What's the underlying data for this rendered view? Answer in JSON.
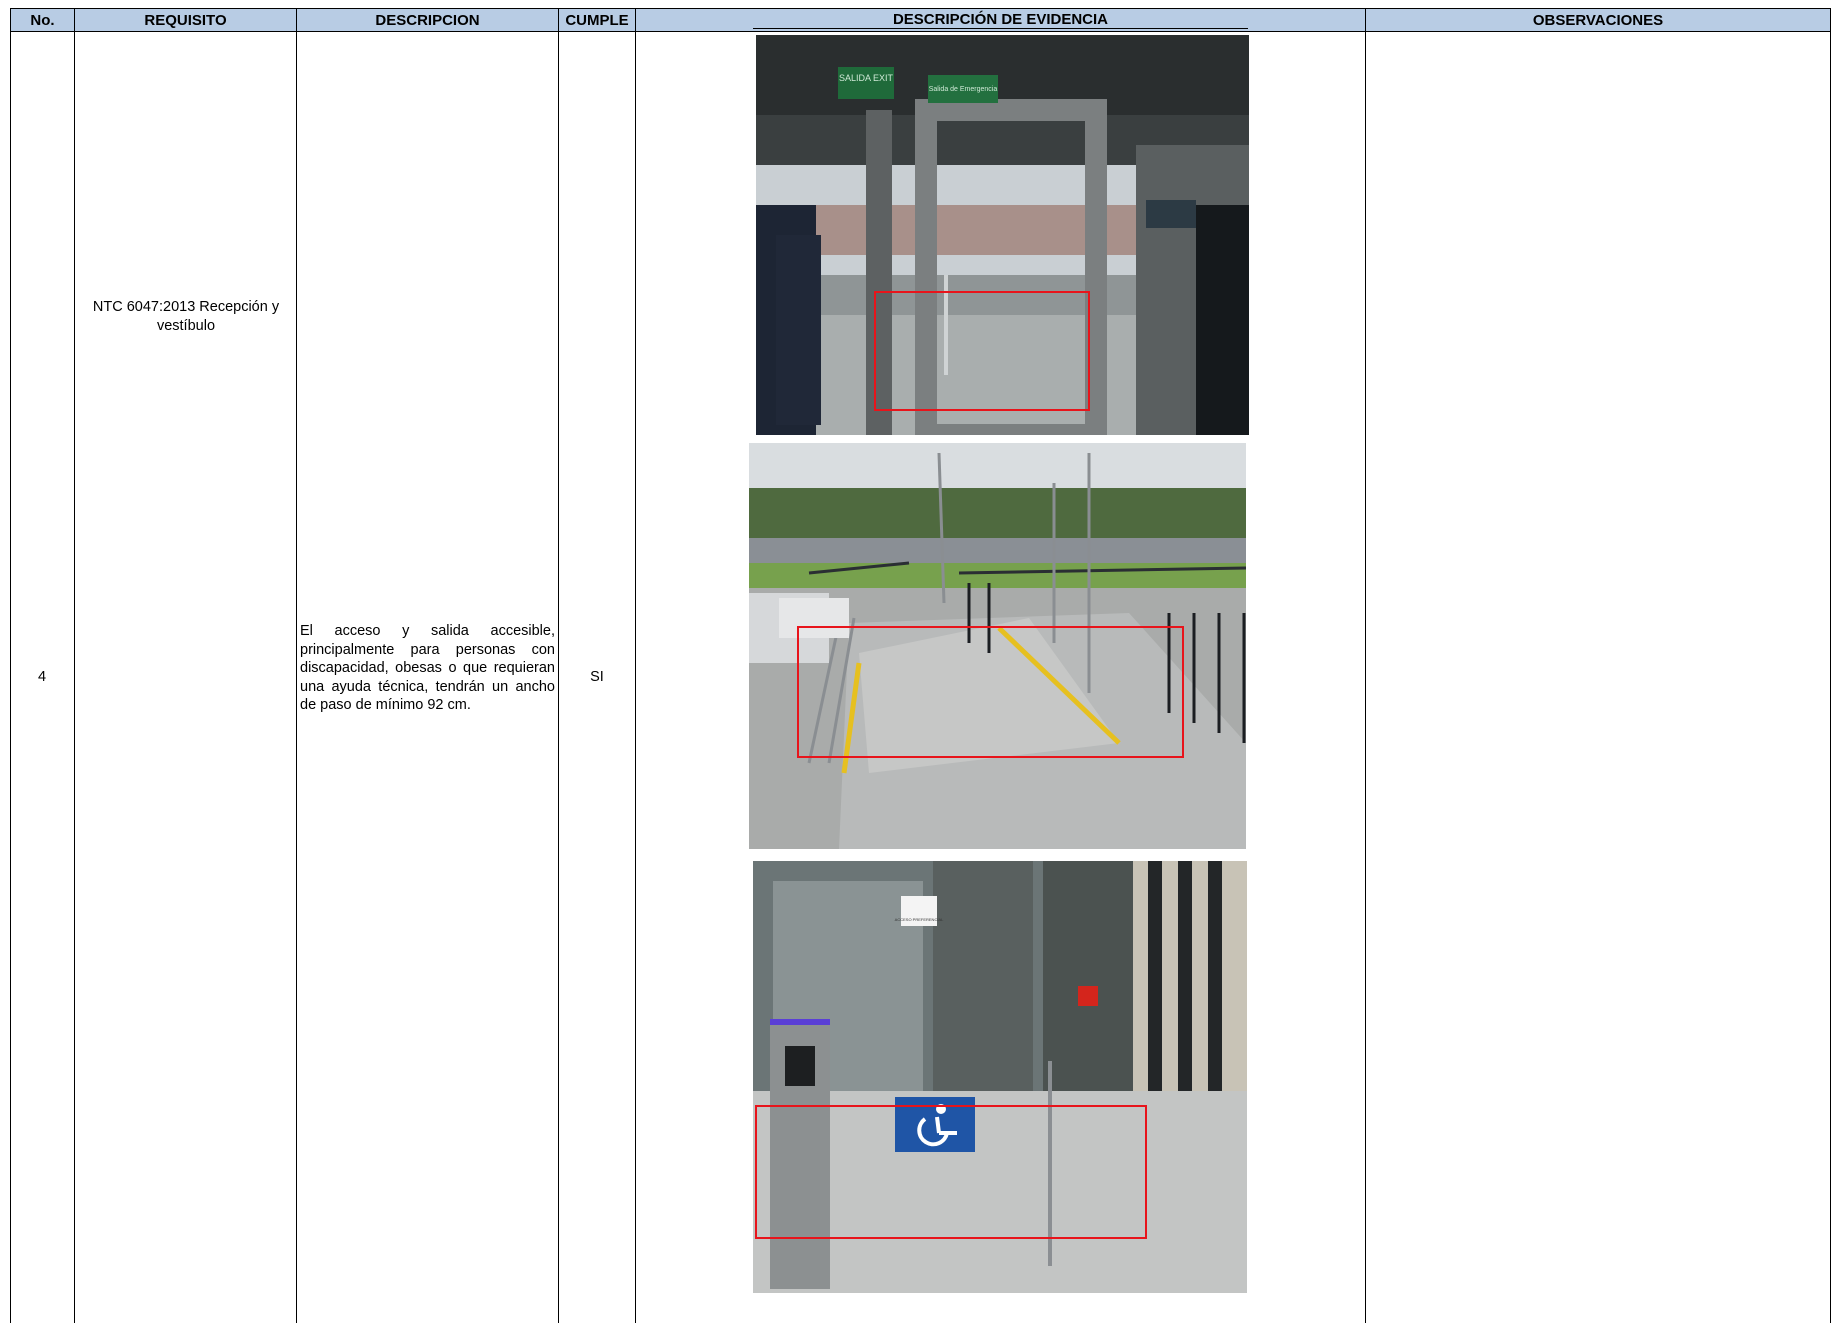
{
  "table": {
    "headers": {
      "no": "No.",
      "requisito": "REQUISITO",
      "descripcion": "DESCRIPCION",
      "cumple": "CUMPLE",
      "evidencia": "DESCRIPCIÓN DE EVIDENCIA",
      "observaciones": "OBSERVACIONES"
    },
    "row": {
      "no": "4",
      "requisito": "NTC 6047:2013 Recepción y vestíbulo",
      "descripcion": "El acceso y salida accesible, principalmente para personas con discapacidad, obesas o que requieran una ayuda técnica, tendrán un ancho de paso de mínimo 92 cm.",
      "cumple": "SI",
      "observaciones": ""
    }
  },
  "photos": {
    "photo1_signs": [
      "SALIDA EXIT",
      "Salida de Emergencia"
    ],
    "photo3_sign": "ACCESO PREFERENCIAL"
  },
  "colors": {
    "header_bg": "#b8cce4",
    "highlight": "#e8141b"
  }
}
